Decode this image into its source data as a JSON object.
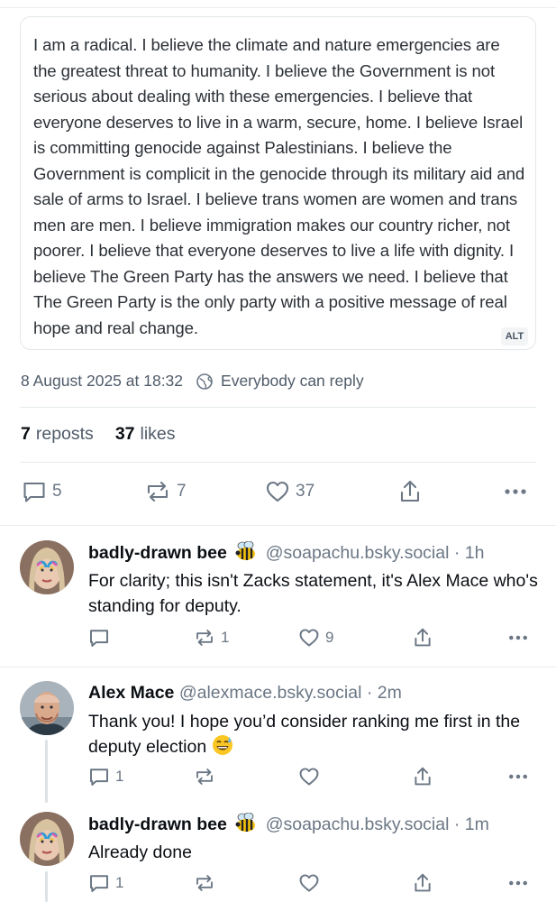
{
  "post": {
    "image_alt_text": "I am a radical. I believe the climate and nature emergencies are the greatest threat to humanity. I believe the Government is not serious about dealing with these emergencies. I believe that everyone deserves to live in a warm, secure, home. I believe Israel is committing genocide against Palestinians. I believe the Government is complicit in the genocide through its military aid and sale of arms to Israel. I believe trans women are women and trans men are men. I believe immigration makes our country richer, not poorer. I believe that everyone deserves to live a life with dignity. I believe The Green Party has the answers we need. I believe that The Green Party is the only party with a positive message of real hope and real change.",
    "alt_badge": "ALT",
    "timestamp": "8 August 2025 at 18:32",
    "reply_setting": "Everybody can reply",
    "reposts_count": "7",
    "reposts_label": "reposts",
    "likes_count": "37",
    "likes_label": "likes",
    "actions": {
      "replies": "5",
      "reposts": "7",
      "likes": "37"
    }
  },
  "replies": [
    {
      "name": "badly-drawn bee",
      "handle": "@soapachu.bsky.social",
      "separator": "·",
      "time": "1h",
      "text": "For clarity; this isn't Zacks statement, it's Alex Mace who's standing for deputy.",
      "counts": {
        "replies": "",
        "reposts": "1",
        "likes": "9"
      }
    },
    {
      "name": "Alex Mace",
      "handle": "@alexmace.bsky.social",
      "separator": "·",
      "time": "2m",
      "text": "Thank you! I hope you’d consider ranking me first in the deputy election",
      "counts": {
        "replies": "1",
        "reposts": "",
        "likes": ""
      }
    },
    {
      "name": "badly-drawn bee",
      "handle": "@soapachu.bsky.social",
      "separator": "·",
      "time": "1m",
      "text": "Already done",
      "counts": {
        "replies": "1",
        "reposts": "",
        "likes": ""
      }
    }
  ],
  "colors": {
    "text": "#0b0f14",
    "muted": "#6b7785",
    "border": "#e6eaee"
  }
}
